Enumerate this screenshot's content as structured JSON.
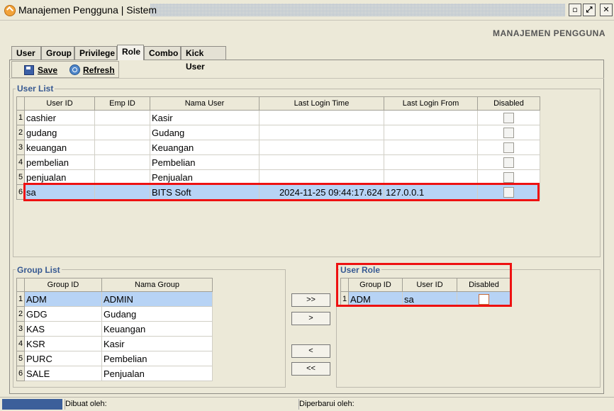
{
  "window": {
    "title": "Manajemen Pengguna | Sistem"
  },
  "header": {
    "title": "MANAJEMEN PENGGUNA"
  },
  "tabs": [
    {
      "label": "User"
    },
    {
      "label": "Group"
    },
    {
      "label": "Privilege"
    },
    {
      "label": "Role",
      "active": true
    },
    {
      "label": "Combo"
    },
    {
      "label": "Kick User"
    }
  ],
  "toolbar": {
    "save_label": "Save",
    "refresh_label": "Refresh"
  },
  "user_list": {
    "title": "User List",
    "columns": [
      "User ID",
      "Emp ID",
      "Nama User",
      "Last Login Time",
      "Last Login From",
      "Disabled"
    ],
    "rows": [
      {
        "n": "1",
        "user_id": "cashier",
        "emp_id": "",
        "nama": "Kasir",
        "login_time": "",
        "login_from": ""
      },
      {
        "n": "2",
        "user_id": "gudang",
        "emp_id": "",
        "nama": "Gudang",
        "login_time": "",
        "login_from": ""
      },
      {
        "n": "3",
        "user_id": "keuangan",
        "emp_id": "",
        "nama": "Keuangan",
        "login_time": "",
        "login_from": ""
      },
      {
        "n": "4",
        "user_id": "pembelian",
        "emp_id": "",
        "nama": "Pembelian",
        "login_time": "",
        "login_from": ""
      },
      {
        "n": "5",
        "user_id": "penjualan",
        "emp_id": "",
        "nama": "Penjualan",
        "login_time": "",
        "login_from": ""
      },
      {
        "n": "6",
        "user_id": "sa",
        "emp_id": "",
        "nama": "BITS Soft",
        "login_time": "2024-11-25 09:44:17.624",
        "login_from": "127.0.0.1"
      }
    ]
  },
  "group_list": {
    "title": "Group List",
    "columns": [
      "Group ID",
      "Nama Group"
    ],
    "rows": [
      {
        "n": "1",
        "group_id": "ADM",
        "nama": "ADMIN"
      },
      {
        "n": "2",
        "group_id": "GDG",
        "nama": "Gudang"
      },
      {
        "n": "3",
        "group_id": "KAS",
        "nama": "Keuangan"
      },
      {
        "n": "4",
        "group_id": "KSR",
        "nama": "Kasir"
      },
      {
        "n": "5",
        "group_id": "PURC",
        "nama": "Pembelian"
      },
      {
        "n": "6",
        "group_id": "SALE",
        "nama": "Penjualan"
      }
    ]
  },
  "move_buttons": {
    "add_all": ">>",
    "add_one": ">",
    "remove_one": "<",
    "remove_all": "<<"
  },
  "user_role": {
    "title": "User Role",
    "columns": [
      "Group ID",
      "User ID",
      "Disabled"
    ],
    "rows": [
      {
        "n": "1",
        "group_id": "ADM",
        "user_id": "sa"
      }
    ]
  },
  "status": {
    "created_by": "Dibuat oleh:",
    "updated_by": "Diperbarui oleh:"
  },
  "colors": {
    "highlight": "#ee1111",
    "selection": "#b7d3f5",
    "section_label": "#375992"
  }
}
